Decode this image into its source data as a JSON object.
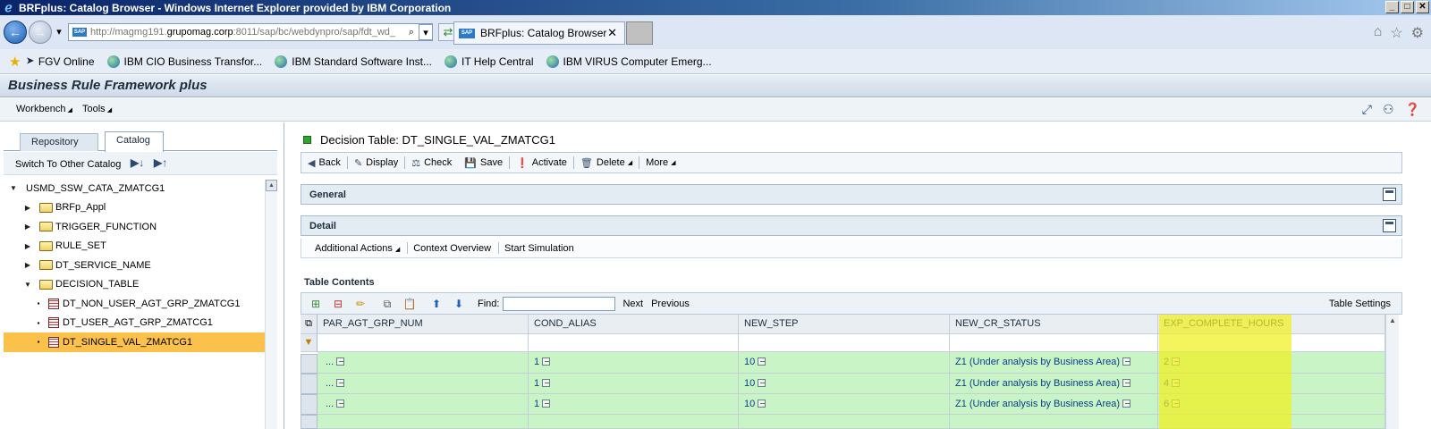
{
  "window": {
    "title": "BRFplus: Catalog Browser - Windows Internet Explorer provided by IBM Corporation"
  },
  "browser": {
    "url_prefix": "http://magmg191.",
    "url_host": "grupomag.corp",
    "url_suffix": ":8011/sap/bc/webdynpro/sap/fdt_wd_",
    "tab_title": "BRFplus: Catalog Browser"
  },
  "favorites": [
    {
      "label": "FGV Online"
    },
    {
      "label": "IBM CIO Business Transfor..."
    },
    {
      "label": "IBM Standard Software Inst..."
    },
    {
      "label": "IT Help Central"
    },
    {
      "label": "IBM VIRUS Computer Emerg..."
    }
  ],
  "app": {
    "title": "Business Rule Framework plus"
  },
  "menu": {
    "workbench": "Workbench",
    "tools": "Tools"
  },
  "left": {
    "tabs": [
      "Repository",
      "Catalog"
    ],
    "active_tab": "Catalog",
    "switch_label": "Switch To Other Catalog",
    "tree": {
      "root": "USMD_SSW_CATA_ZMATCG1",
      "folders": [
        "BRFp_Appl",
        "TRIGGER_FUNCTION",
        "RULE_SET",
        "DT_SERVICE_NAME",
        "DECISION_TABLE"
      ],
      "tables": [
        "DT_NON_USER_AGT_GRP_ZMATCG1",
        "DT_USER_AGT_GRP_ZMATCG1",
        "DT_SINGLE_VAL_ZMATCG1"
      ],
      "selected": "DT_SINGLE_VAL_ZMATCG1"
    }
  },
  "main": {
    "title": "Decision Table: DT_SINGLE_VAL_ZMATCG1",
    "toolbar": {
      "back": "Back",
      "display": "Display",
      "check": "Check",
      "save": "Save",
      "activate": "Activate",
      "delete": "Delete",
      "more": "More"
    },
    "general": "General",
    "detail": "Detail",
    "detail_links": [
      "Additional Actions",
      "Context Overview",
      "Start Simulation"
    ],
    "table_contents": "Table Contents",
    "find_label": "Find:",
    "next": "Next",
    "previous": "Previous",
    "table_settings": "Table Settings",
    "columns": [
      "PAR_AGT_GRP_NUM",
      "COND_ALIAS",
      "NEW_STEP",
      "NEW_CR_STATUS",
      "EXP_COMPLETE_HOURS"
    ],
    "rows": [
      [
        "...",
        "1",
        "10",
        "Z1 (Under analysis by Business Area)",
        "2"
      ],
      [
        "...",
        "1",
        "10",
        "Z1 (Under analysis by Business Area)",
        "4"
      ],
      [
        "...",
        "1",
        "10",
        "Z1 (Under analysis by Business Area)",
        "6"
      ]
    ],
    "highlight_color": "#f0f01e"
  }
}
